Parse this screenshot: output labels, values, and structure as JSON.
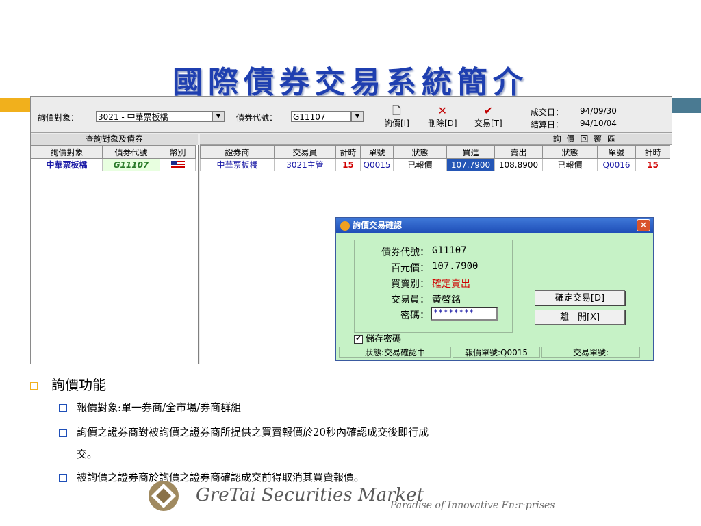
{
  "slide": {
    "title": "國際債券交易系統簡介"
  },
  "toolbar": {
    "inquiry_target_label": "詢價對象：",
    "inquiry_target_value": "3021 - 中華票板橋",
    "bond_code_label": "債券代號：",
    "bond_code_value": "G11107",
    "buttons": [
      {
        "label": "詢價[I]",
        "icon": "new-doc-icon"
      },
      {
        "label": "刪除[D]",
        "icon": "delete-x-icon"
      },
      {
        "label": "交易[T]",
        "icon": "checkmark-icon"
      }
    ],
    "trade_date_label": "成交日：",
    "trade_date_value": "94/09/30",
    "settle_date_label": "結算日：",
    "settle_date_value": "94/10/04"
  },
  "left_panel": {
    "title": "查詢對象及債券",
    "headers": [
      "詢價對象",
      "債券代號",
      "幣別"
    ],
    "rows": [
      {
        "target": "中華票板橋",
        "code": "G11107",
        "currency_icon": "us-flag-icon"
      }
    ]
  },
  "right_panel": {
    "title": "詢 價 回 覆 區",
    "headers": [
      "證券商",
      "交易員",
      "計時",
      "單號",
      "狀態",
      "買進",
      "賣出",
      "狀態",
      "單號",
      "計時"
    ],
    "rows": [
      [
        "中華票板橋",
        "3021主管",
        "15",
        "Q0015",
        "已報價",
        "107.7900",
        "108.8900",
        "已報價",
        "Q0016",
        "15"
      ]
    ]
  },
  "dialog": {
    "title": "詢價交易確認",
    "fields": [
      {
        "label": "債券代號：",
        "value": "G11107"
      },
      {
        "label": "百元價：",
        "value": "107.7900"
      },
      {
        "label": "買賣別：",
        "value": "確定賣出"
      },
      {
        "label": "交易員：",
        "value": "黃啓銘"
      },
      {
        "label": "密碼：",
        "value": "********"
      }
    ],
    "confirm_button": "確定交易[D]",
    "leave_button": "離　開[X]",
    "save_password_label": "儲存密碼",
    "save_password_checked": "✔",
    "status": "狀態:交易確認中",
    "quote_no": "報價單號:Q0015",
    "trade_no": "交易單號:"
  },
  "bullets": {
    "main": "詢價功能",
    "items": [
      "報價對象:單一券商/全市場/券商群組",
      "詢價之證券商對被詢價之證券商所提供之買賣報價於20秒內確認成交後即行成",
      "交。",
      "被詢價之證券商於詢價之證券商確認成交前得取消其買賣報價。"
    ]
  },
  "footer": {
    "name": "GreTai Securities Market",
    "tagline": "Paradise of Innovative En:r·prises"
  },
  "colors": {
    "title": "#1f3fb0",
    "accent_orange": "#f1b01c",
    "accent_teal": "#4a7a92",
    "dialog_bg": "#c6f2c6",
    "alert_red": "#d00000"
  }
}
